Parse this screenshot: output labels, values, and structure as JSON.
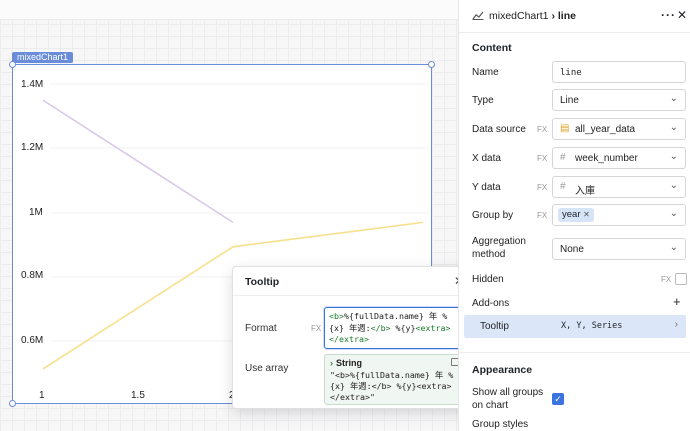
{
  "canvas": {
    "component_label": "mixedChart1",
    "chart_data": {
      "type": "line",
      "title": "",
      "xlabel": "",
      "ylabel": "",
      "x_ticks": [
        "1",
        "1.5",
        "2",
        "2"
      ],
      "y_ticks": [
        "1.4M",
        "1.2M",
        "1M",
        "0.8M",
        "0.6M"
      ],
      "xlim": [
        1,
        3
      ],
      "ylim": [
        0.5,
        1.45
      ],
      "series": [
        {
          "color": "#d8c8ea",
          "x": [
            1,
            2
          ],
          "y": [
            1.4,
            1.0
          ]
        },
        {
          "color": "#f7e08c",
          "x": [
            1,
            2,
            3
          ],
          "y": [
            0.52,
            0.92,
            1.0
          ]
        }
      ]
    }
  },
  "tooltip_popup": {
    "title": "Tooltip",
    "close_icon": "close-icon",
    "format_label": "Format",
    "fx_label": "FX",
    "format_value_line1_a": "<b>",
    "format_value_line1_b": "%{fullData.name} 年 %",
    "format_value_line2_a": "{x} 年週:",
    "format_value_line2_b": "</b>",
    "format_value_line2_c": " %{y}",
    "format_value_line2_d": "<extra>",
    "format_value_line3": "</extra>",
    "use_array_label": "Use array",
    "hint_type": "String",
    "hint_value": "\"<b>%{fullData.name} 年 %\n{x} 年週:</b> %{y}<extra>\n</extra>\""
  },
  "panel": {
    "header": {
      "icon": "line-chart-icon",
      "parent": "mixedChart1",
      "separator": "›",
      "name": "line",
      "more": "···",
      "close": "✕"
    },
    "content_title": "Content",
    "name": {
      "label": "Name",
      "value": "line"
    },
    "type": {
      "label": "Type",
      "value": "Line"
    },
    "data_source": {
      "label": "Data source",
      "fx": "FX",
      "value": "all_year_data",
      "icon": "table-icon"
    },
    "x_data": {
      "label": "X data",
      "fx": "FX",
      "value": "week_number",
      "icon": "hash-icon"
    },
    "y_data": {
      "label": "Y data",
      "fx": "FX",
      "value": "入庫",
      "icon": "hash-icon"
    },
    "group_by": {
      "label": "Group by",
      "fx": "FX",
      "chip": "year",
      "chip_x": "✕"
    },
    "aggregation": {
      "label_line1": "Aggregation",
      "label_line2": "method",
      "value": "None"
    },
    "hidden": {
      "label": "Hidden",
      "fx": "FX",
      "checked": false
    },
    "addons": {
      "label": "Add-ons",
      "add": "+",
      "item": "Tooltip",
      "item_value": "X, Y, Series",
      "chevron": "›"
    },
    "appearance_title": "Appearance",
    "show_all_groups": {
      "label_line1": "Show all groups",
      "label_line2": "on chart",
      "checked": true,
      "check": "✓"
    },
    "group_styles_label": "Group styles"
  }
}
